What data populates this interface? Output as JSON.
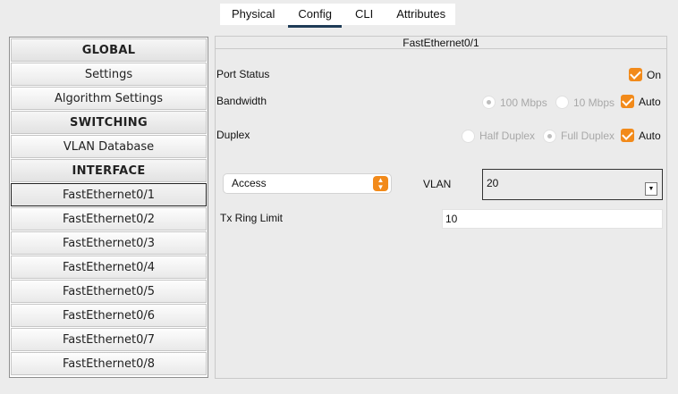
{
  "tabs": [
    {
      "label": "Physical"
    },
    {
      "label": "Config"
    },
    {
      "label": "CLI"
    },
    {
      "label": "Attributes"
    }
  ],
  "sidebar": {
    "items": [
      {
        "label": "GLOBAL",
        "type": "header"
      },
      {
        "label": "Settings"
      },
      {
        "label": "Algorithm Settings"
      },
      {
        "label": "SWITCHING",
        "type": "header"
      },
      {
        "label": "VLAN Database"
      },
      {
        "label": "INTERFACE",
        "type": "header"
      },
      {
        "label": "FastEthernet0/1",
        "selected": true
      },
      {
        "label": "FastEthernet0/2"
      },
      {
        "label": "FastEthernet0/3"
      },
      {
        "label": "FastEthernet0/4"
      },
      {
        "label": "FastEthernet0/5"
      },
      {
        "label": "FastEthernet0/6"
      },
      {
        "label": "FastEthernet0/7"
      },
      {
        "label": "FastEthernet0/8"
      }
    ]
  },
  "panel": {
    "title": "FastEthernet0/1",
    "port_status": {
      "label": "Port Status",
      "on_label": "On",
      "checked": true
    },
    "bandwidth": {
      "label": "Bandwidth",
      "opt1": "100 Mbps",
      "opt2": "10 Mbps",
      "auto_label": "Auto",
      "auto_checked": true
    },
    "duplex": {
      "label": "Duplex",
      "opt1": "Half Duplex",
      "opt2": "Full Duplex",
      "auto_label": "Auto",
      "auto_checked": true
    },
    "mode": {
      "value": "Access"
    },
    "vlan": {
      "label": "VLAN",
      "value": "20"
    },
    "tx_ring": {
      "label": "Tx Ring Limit",
      "value": "10"
    }
  },
  "colors": {
    "accent": "#f28a1a",
    "tab_underline": "#1f3c57"
  }
}
